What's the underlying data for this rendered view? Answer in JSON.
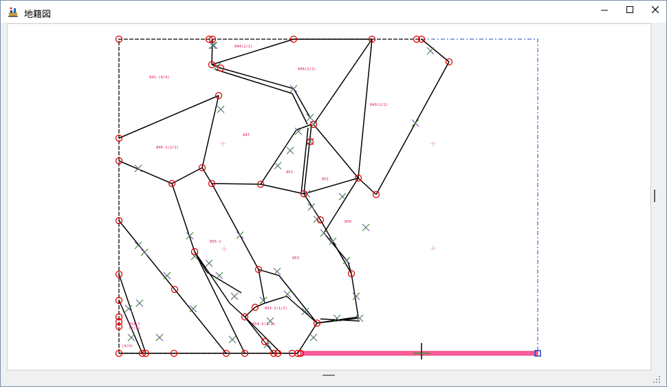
{
  "window": {
    "title": "地籍図",
    "icon": "cadastral-map-app-icon",
    "controls": {
      "minimize": "minimize-icon",
      "maximize": "maximize-icon",
      "close": "close-icon"
    }
  },
  "map": {
    "parcel_labels": [
      "844(2/2)",
      "841-(4/4)",
      "848(2/2)",
      "849(2/2)",
      "847",
      "846-1(2/2)",
      "852",
      "851",
      "850",
      "855-1",
      "853",
      "854-1(1/2)",
      "854-5(1/2)",
      "852-1",
      "(2/3)",
      "(4/4)"
    ],
    "colors": {
      "boundary": "#000000",
      "point_marker": "#e00000",
      "cross_marker": "#3a8a3a",
      "label": "#e0106a",
      "selection": "#ff5c9a",
      "dash_frame": "#2040c0"
    }
  }
}
